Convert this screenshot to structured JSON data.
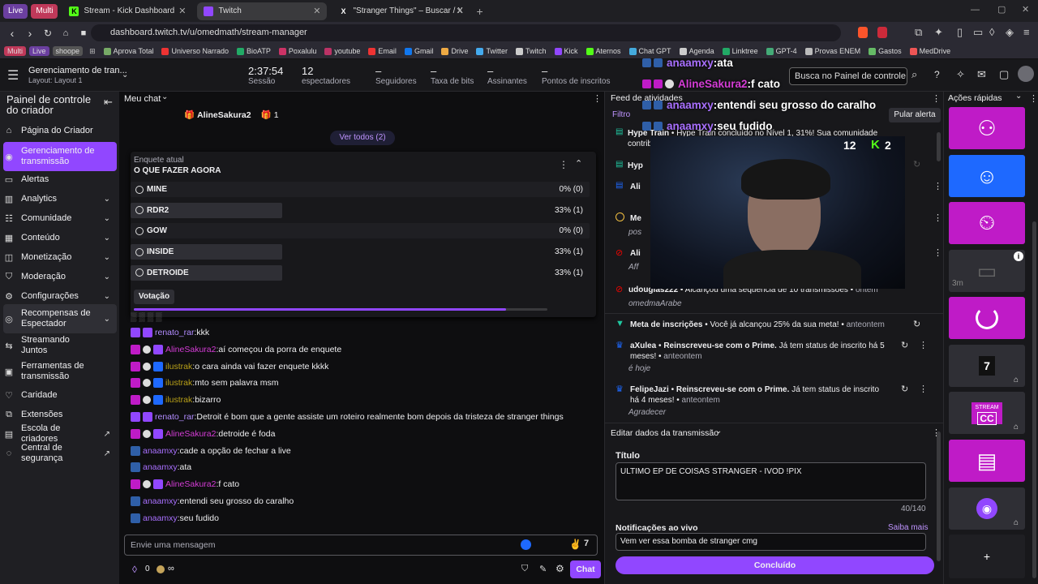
{
  "browser": {
    "tabs": [
      {
        "label": "Live",
        "kind": "pill"
      },
      {
        "label": "Multi",
        "kind": "pill"
      },
      {
        "label": "Stream - Kick Dashboard"
      },
      {
        "label": "Twitch",
        "active": true
      },
      {
        "label": "\"Stranger Things\" – Buscar / X"
      }
    ],
    "url": "dashboard.twitch.tv/u/omedmath/stream-manager",
    "bookmarks": [
      "Multi",
      "Live",
      "shoope",
      "Aprova Total",
      "Universo Narrado",
      "BioATP",
      "Poxalulu",
      "youtube",
      "Email",
      "Gmail",
      "Drive",
      "Twitter",
      "Twitch",
      "Kick",
      "Aternos",
      "Chat GPT",
      "Agenda",
      "Linktree",
      "GPT-4",
      "Provas ENEM",
      "Gastos",
      "MedDrive"
    ]
  },
  "header": {
    "title": "Gerenciamento de tran...",
    "layout": "Layout: Layout 1",
    "stats": [
      {
        "value": "2:37:54",
        "label": "Sessão"
      },
      {
        "value": "12",
        "label": "espectadores"
      },
      {
        "value": "–",
        "label": "Seguidores"
      },
      {
        "value": "–",
        "label": "Taxa de bits"
      },
      {
        "value": "–",
        "label": "Assinantes"
      },
      {
        "value": "–",
        "label": "Pontos de inscritos"
      }
    ],
    "search_placeholder": "Busca no Painel de controle (C"
  },
  "sidebar": {
    "title": "Painel de controle do criador",
    "items": [
      {
        "label": "Página do Criador",
        "icon": "home-icon"
      },
      {
        "label": "Gerenciamento de transmissão",
        "icon": "broadcast-icon",
        "active": true
      },
      {
        "label": "Alertas",
        "icon": "alert-icon"
      },
      {
        "label": "Analytics",
        "icon": "analytics-icon",
        "expand": true
      },
      {
        "label": "Comunidade",
        "icon": "community-icon",
        "expand": true
      },
      {
        "label": "Conteúdo",
        "icon": "content-icon",
        "expand": true
      },
      {
        "label": "Monetização",
        "icon": "money-icon",
        "expand": true
      },
      {
        "label": "Moderação",
        "icon": "shield-icon",
        "expand": true
      },
      {
        "label": "Configurações",
        "icon": "gear-icon",
        "expand": true
      },
      {
        "label": "Recompensas de Espectador",
        "icon": "reward-icon",
        "expand": true
      },
      {
        "label": "Streamando Juntos",
        "icon": "together-icon"
      },
      {
        "label": "Ferramentas de transmissão",
        "icon": "tools-icon"
      },
      {
        "label": "Caridade",
        "icon": "charity-icon"
      },
      {
        "label": "Extensões",
        "icon": "extensions-icon"
      },
      {
        "label": "Escola de criadores",
        "icon": "school-icon",
        "external": true
      },
      {
        "label": "Central de segurança",
        "icon": "safety-icon",
        "external": true
      }
    ]
  },
  "chat": {
    "title": "Meu chat",
    "gift_user": "AlineSakura2",
    "gift_count": "1",
    "see_all": "Ver todos (2)",
    "poll": {
      "label": "Enquete atual",
      "question": "O QUE FAZER AGORA",
      "options": [
        {
          "name": "MINE",
          "result": "0% (0)",
          "fraction": 0
        },
        {
          "name": "RDR2",
          "result": "33% (1)",
          "fraction": 0.33
        },
        {
          "name": "GOW",
          "result": "0% (0)",
          "fraction": 0
        },
        {
          "name": "INSIDE",
          "result": "33% (1)",
          "fraction": 0.33
        },
        {
          "name": "DETROIDE",
          "result": "33% (1)",
          "fraction": 0.33
        }
      ],
      "button": "Votação",
      "progress": 0.9
    },
    "messages": [
      {
        "user": "renato_rar",
        "color": "#b28cff",
        "text": "kkk"
      },
      {
        "user": "AlineSakura2",
        "color": "#d53cd6",
        "text": "aí começou da porra de enquete"
      },
      {
        "user": "ilustrak",
        "color": "#b8a018",
        "text": "o cara ainda vai fazer enquete kkkk"
      },
      {
        "user": "ilustrak",
        "color": "#b8a018",
        "text": "mto sem palavra msm"
      },
      {
        "user": "ilustrak",
        "color": "#b8a018",
        "text": "bizarro"
      },
      {
        "user": "renato_rar",
        "color": "#b28cff",
        "text": "Detroit é bom que a gente assiste um roteiro realmente bom depois da tristeza de stranger things"
      },
      {
        "user": "AlineSakura2",
        "color": "#d53cd6",
        "text": "detroide é foda"
      },
      {
        "user": "anaamxy",
        "color": "#a970ff",
        "text": "cade a opção de fechar a live"
      },
      {
        "user": "anaamxy",
        "color": "#a970ff",
        "text": "ata"
      },
      {
        "user": "AlineSakura2",
        "color": "#d53cd6",
        "text": "f cato"
      },
      {
        "user": "anaamxy",
        "color": "#a970ff",
        "text": "entendi seu grosso do caralho"
      },
      {
        "user": "anaamxy",
        "color": "#a970ff",
        "text": "seu fudido"
      }
    ],
    "input_placeholder": "Envie uma mensagem",
    "points": "0",
    "chat_button": "Chat"
  },
  "overlay": {
    "lines": [
      {
        "user": "anaamxy",
        "text": "ata"
      },
      {
        "user": "AlineSakura2",
        "text": "f cato"
      },
      {
        "user": "anaamxy",
        "text": "entendi seu grosso do caralho"
      },
      {
        "user": "anaamxy",
        "text": "seu fudido"
      }
    ],
    "viewers_twitch": "12",
    "viewers_kick": "2"
  },
  "activity": {
    "title": "Feed de atividades",
    "filter": "Filtro",
    "skip": "Pular alerta",
    "hype_title": "Hype Train",
    "hype_text": "Hype Train concluído no Nível 1, 31%! Sua comunidade contribuiu com",
    "hyp": "Hyp",
    "ali1": "Ali",
    "me": "Me",
    "pos": "pos",
    "ali2": "Ali",
    "aff": "Aff",
    "streak_user": "udouglas222",
    "streak_text": "Alcançou uma sequência de 10 transmissões",
    "streak_time": "ontem",
    "streak_sub": "omedmaArabe",
    "goal_title": "Meta de inscrições",
    "goal_text": "Você já alcançou 25% da sua meta!",
    "goal_time": "anteontem",
    "subs": [
      {
        "user": "aXulea",
        "text": "Reinscreveu-se com o",
        "tier": "Prime.",
        "rest": "Já tem status de inscrito há 5 meses!",
        "time": "anteontem",
        "msg": "é hoje"
      },
      {
        "user": "FelipeJazi",
        "text": "Reinscreveu-se com o",
        "tier": "Prime.",
        "rest": "Já tem status de inscrito há 4 meses!",
        "time": "anteontem",
        "msg": "Agradecer"
      }
    ]
  },
  "edit": {
    "title": "Editar dados da transmissão",
    "title_label": "Título",
    "title_value": "ULTIMO EP DE COISAS STRANGER - IVOD !PIX",
    "counter": "40/140",
    "notif_label": "Notificações ao vivo",
    "learn_more": "Saiba mais",
    "notif_value": "Vem ver essa bomba de stranger cmg",
    "done": "Concluído"
  },
  "quick": {
    "title": "Ações rápidas",
    "tile_labels": [
      "STREAM",
      "CC"
    ],
    "timer": "3m",
    "add": "+",
    "colors": {
      "purple": "#bf1bc7",
      "blue": "#1e69ff",
      "dark": "#2f2f35",
      "accent": "#9147ff"
    }
  }
}
